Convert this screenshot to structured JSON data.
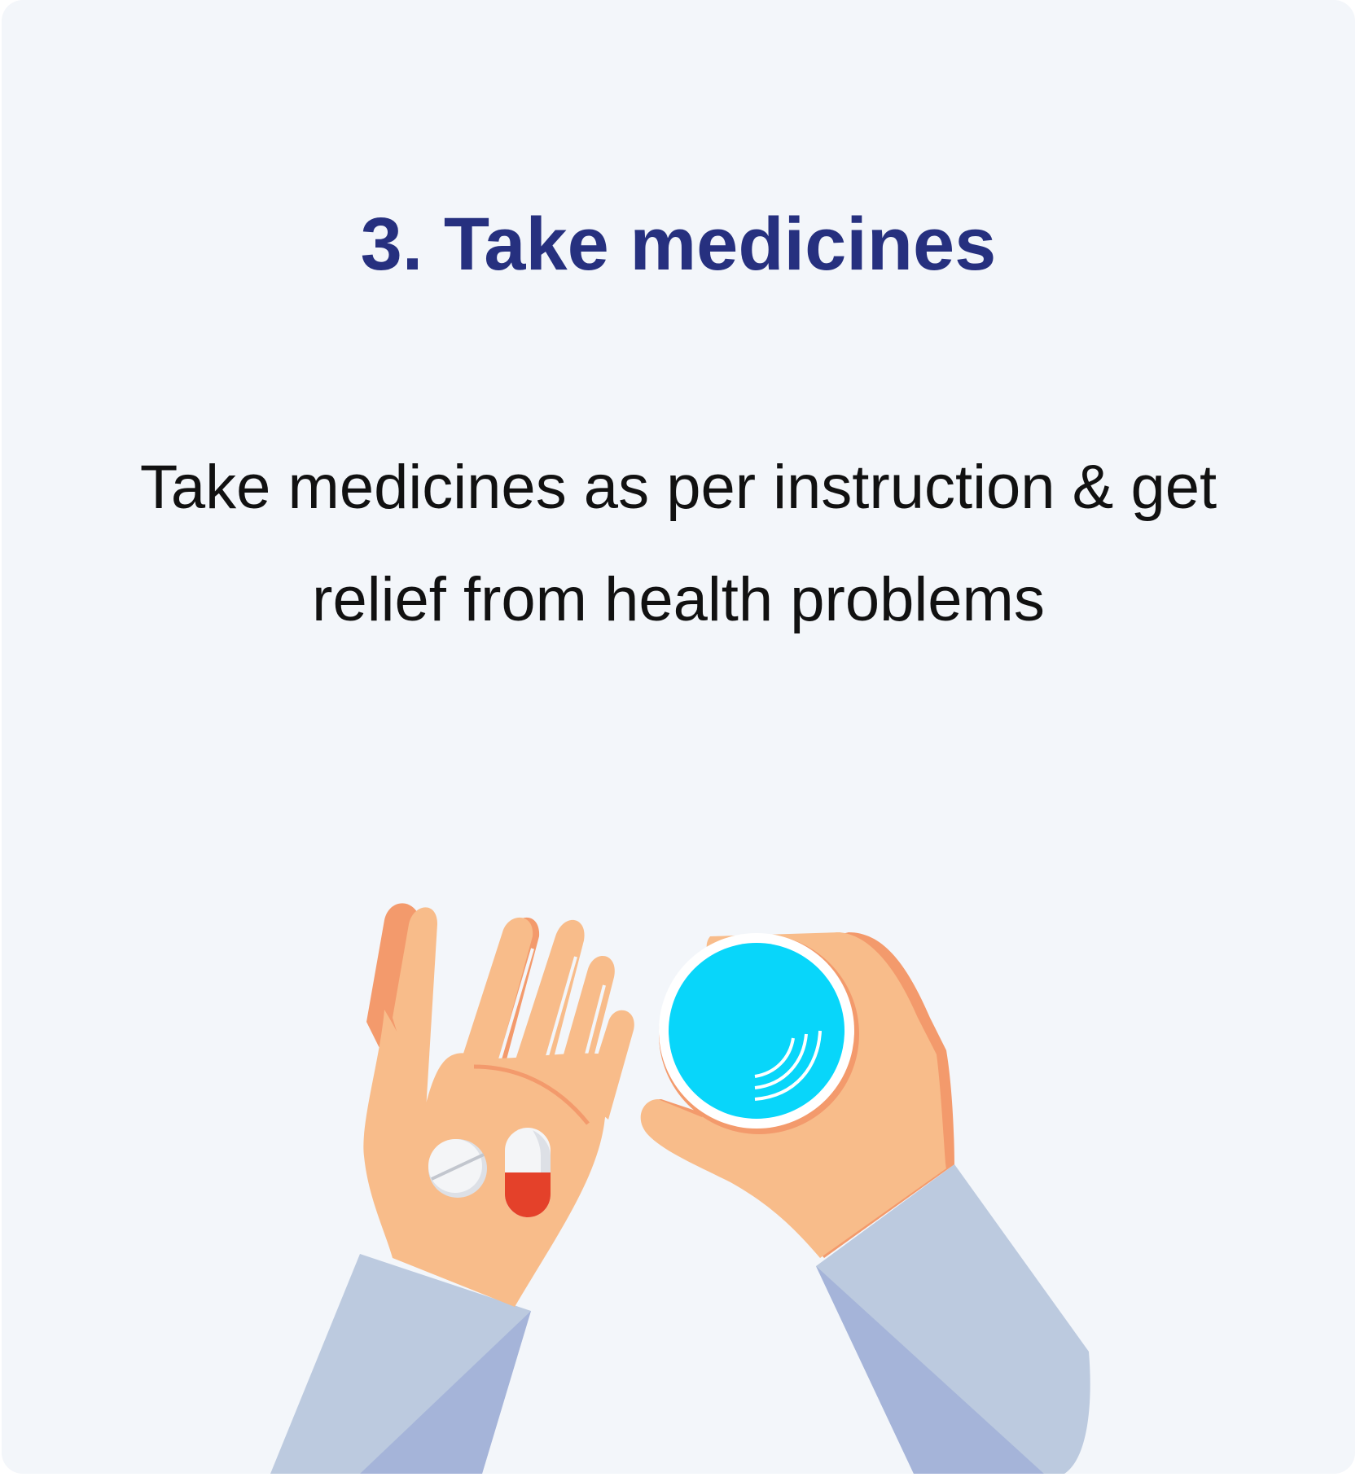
{
  "card": {
    "title": "3. Take medicines",
    "description": "Take medicines as per instruction & get relief from health problems"
  },
  "colors": {
    "background": "#f3f6fa",
    "title": "#26307f",
    "text": "#111111",
    "skin": "#f8bc8a",
    "skin_shadow": "#f39a6c",
    "sleeve": "#bccadf",
    "sleeve_shadow": "#a5b4d9",
    "water": "#08d6fa",
    "capsule_red": "#e4412a"
  },
  "illustration": {
    "icons": [
      "open-hand-icon",
      "tablet-pill-icon",
      "capsule-pill-icon",
      "hand-holding-glass-icon",
      "water-glass-icon"
    ]
  }
}
